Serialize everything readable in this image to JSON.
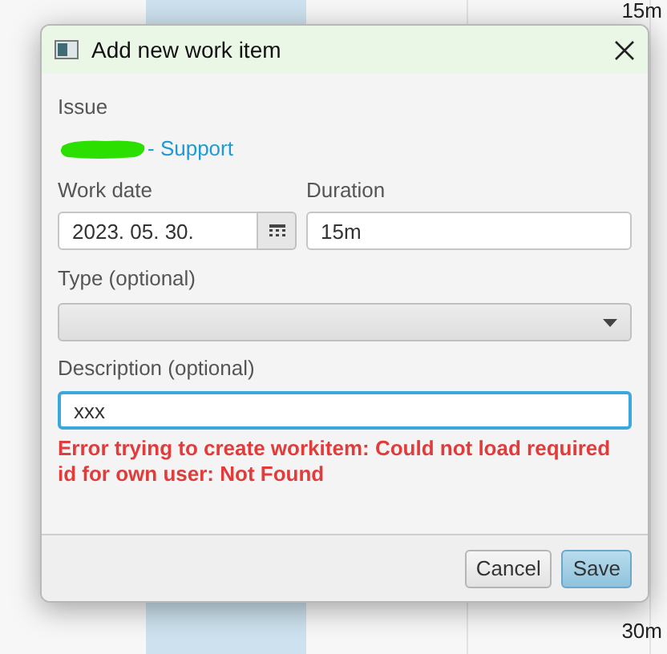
{
  "background": {
    "durations": [
      "15m",
      "30m"
    ]
  },
  "dialog": {
    "title": "Add new work item",
    "issue": {
      "label": "Issue",
      "link": "- Support"
    },
    "work_date": {
      "label": "Work date",
      "value": "2023. 05. 30."
    },
    "duration": {
      "label": "Duration",
      "value": "15m"
    },
    "type": {
      "label": "Type (optional)"
    },
    "description": {
      "label": "Description (optional)",
      "value": "xxx",
      "focused": true
    },
    "error": "Error trying to create workitem: Could not load required id for own user: Not Found",
    "buttons": [
      {
        "label": "Cancel",
        "default": false
      },
      {
        "label": "Save",
        "default": true
      }
    ]
  }
}
